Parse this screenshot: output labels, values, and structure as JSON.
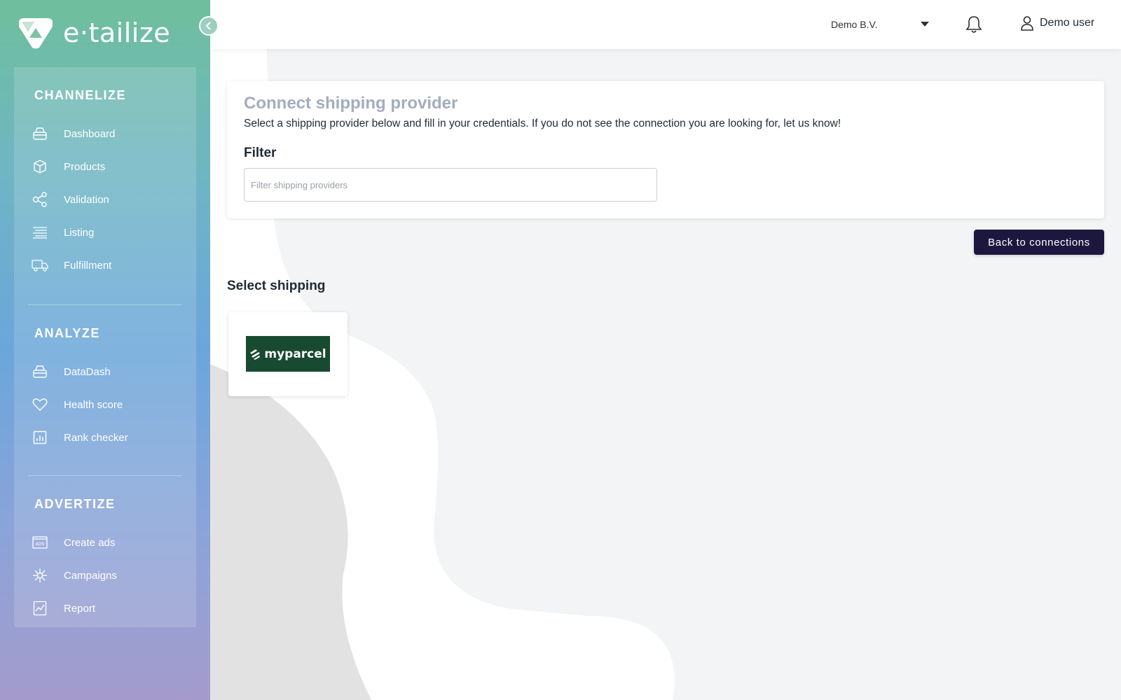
{
  "brand": {
    "name": "e·tailize"
  },
  "sidebar": {
    "sections": [
      {
        "title": "CHANNELIZE",
        "items": [
          {
            "label": "Dashboard",
            "icon": "dashboard-icon"
          },
          {
            "label": "Products",
            "icon": "box-icon"
          },
          {
            "label": "Validation",
            "icon": "share-nodes-icon"
          },
          {
            "label": "Listing",
            "icon": "list-icon"
          },
          {
            "label": "Fulfillment",
            "icon": "truck-icon"
          }
        ]
      },
      {
        "title": "ANALYZE",
        "items": [
          {
            "label": "DataDash",
            "icon": "dashboard-icon"
          },
          {
            "label": "Health score",
            "icon": "heart-icon"
          },
          {
            "label": "Rank checker",
            "icon": "bar-chart-icon"
          }
        ]
      },
      {
        "title": "ADVERTIZE",
        "items": [
          {
            "label": "Create ads",
            "icon": "ads-icon"
          },
          {
            "label": "Campaigns",
            "icon": "campaigns-icon"
          },
          {
            "label": "Report",
            "icon": "report-icon"
          }
        ]
      }
    ]
  },
  "topbar": {
    "company": "Demo B.V.",
    "user": "Demo user"
  },
  "card": {
    "title": "Connect shipping provider",
    "description": "Select a shipping provider below and fill in your credentials. If you do not see the connection you are looking for, let us know!",
    "filter_label": "Filter",
    "filter_placeholder": "Filter shipping providers",
    "filter_value": ""
  },
  "actions": {
    "back_label": "Back to connections"
  },
  "shipping": {
    "heading": "Select shipping",
    "providers": [
      {
        "name": "myparcel"
      }
    ]
  },
  "colors": {
    "sidebar_gradient_top": "#6fbf9c",
    "sidebar_gradient_bottom": "#a49bcc",
    "primary_button": "#1d1740",
    "title_muted": "#a3adbf",
    "myparcel_green": "#174a30"
  }
}
